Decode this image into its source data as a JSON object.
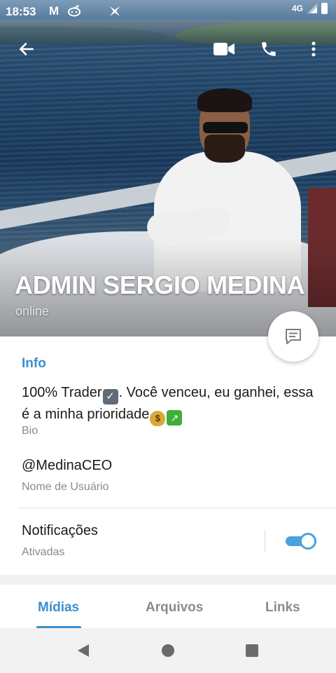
{
  "statusbar": {
    "time": "18:53",
    "network": "4G",
    "icons": [
      "gmail-icon",
      "reddit-icon",
      "app-icon"
    ]
  },
  "appbar": {
    "icons": [
      "back-arrow-icon",
      "video-call-icon",
      "phone-icon",
      "more-vert-icon"
    ]
  },
  "profile": {
    "name": "ADMIN SERGIO MEDINA",
    "status": "online"
  },
  "info": {
    "header": "Info",
    "bio_text_1": "100% Trader",
    "bio_text_2": ". Você venceu, eu ganhei, essa é a minha prioridade",
    "bio_label": "Bio",
    "username": "@MedinaCEO",
    "username_label": "Nome de Usuário",
    "notifications_title": "Notificações",
    "notifications_state": "Ativadas",
    "notifications_enabled": true
  },
  "tabs": [
    {
      "label": "Mídias",
      "active": true
    },
    {
      "label": "Arquivos",
      "active": false
    },
    {
      "label": "Links",
      "active": false
    }
  ],
  "colors": {
    "accent": "#3a8fd0",
    "toggle": "#4ba1e0",
    "muted_text": "#8a8a8a"
  }
}
